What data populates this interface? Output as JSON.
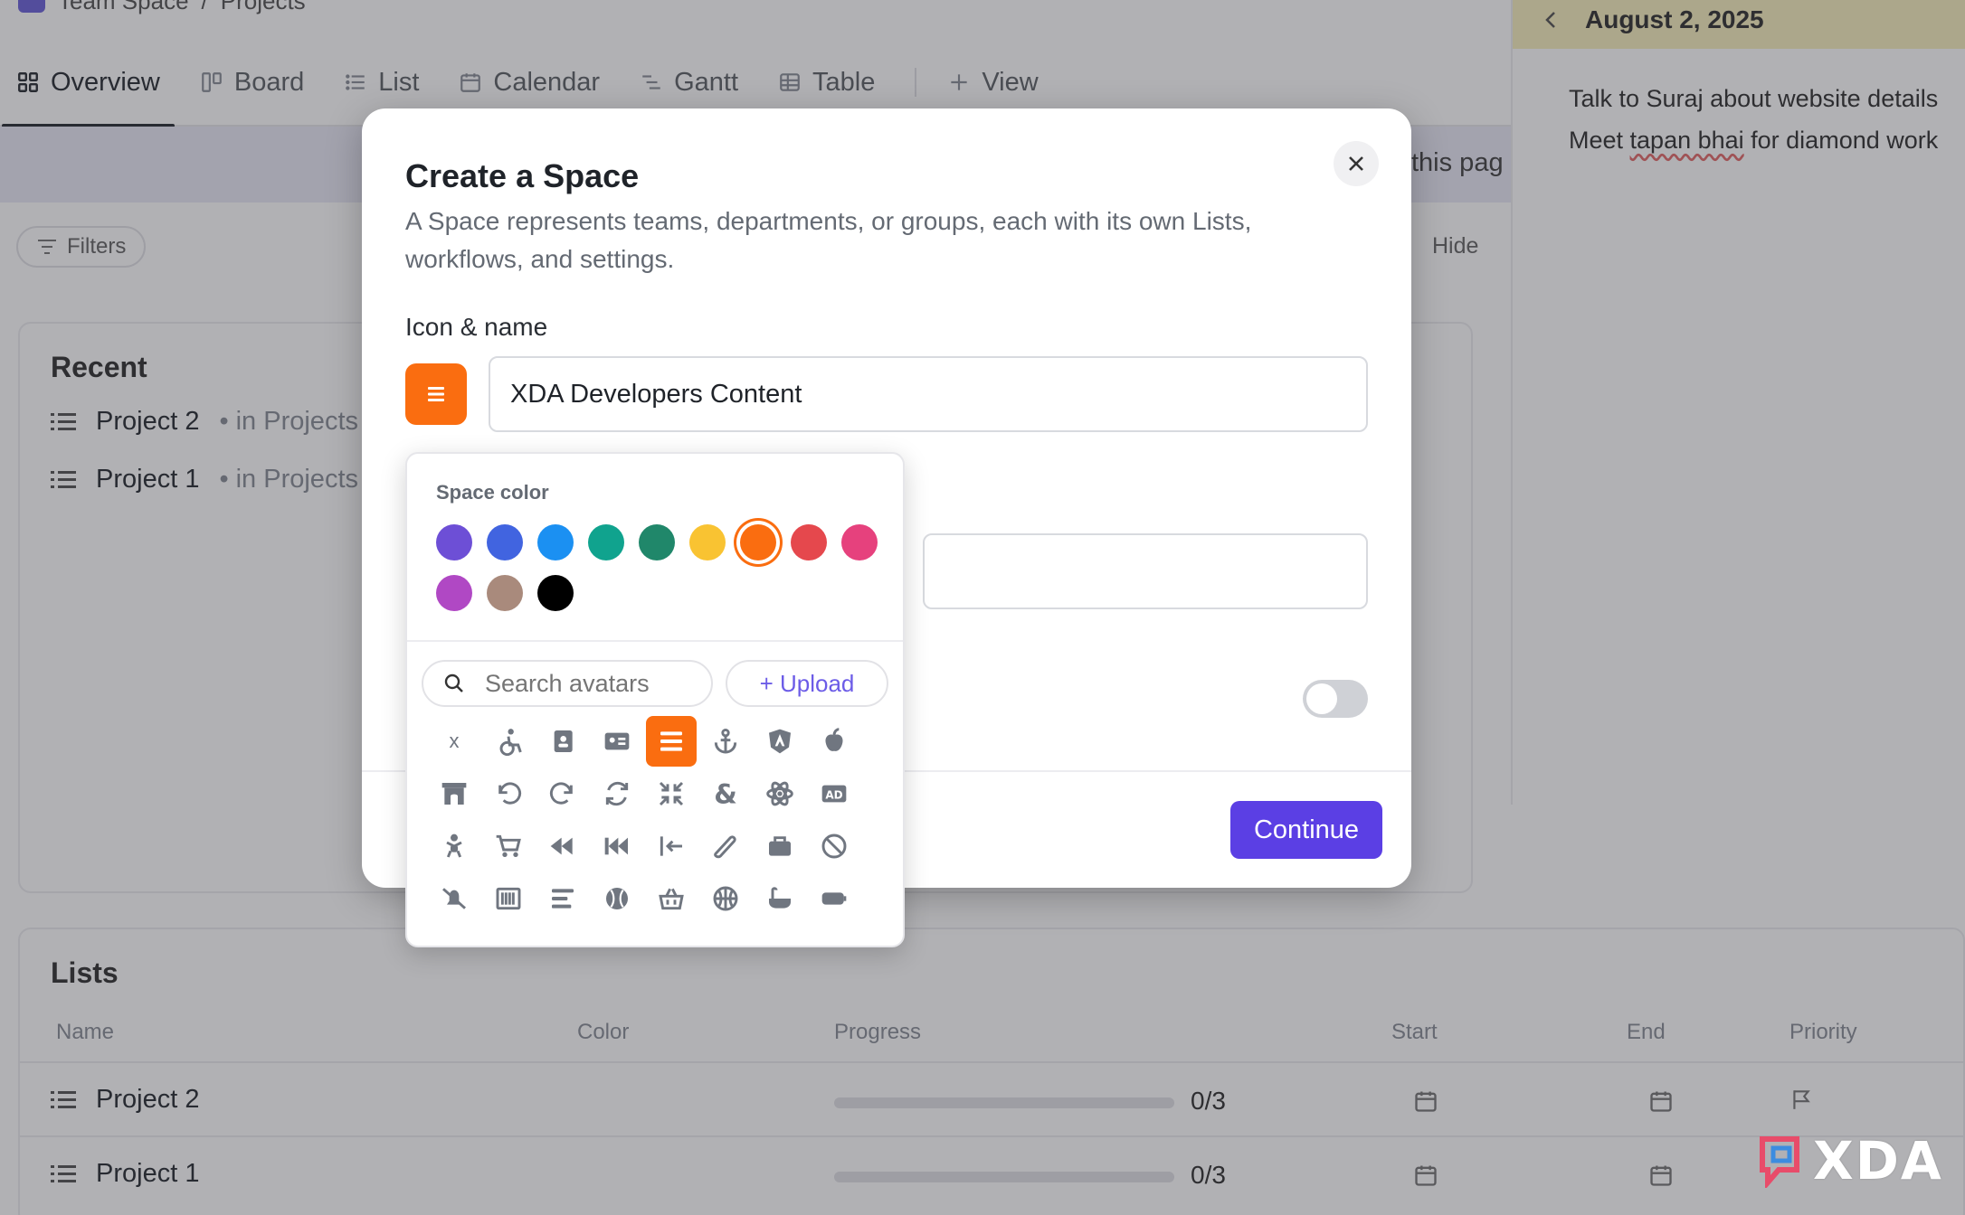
{
  "breadcrumb": {
    "space": "Team Space",
    "folder": "Projects"
  },
  "tabs": [
    {
      "label": "Overview",
      "icon": "overview-grid-icon"
    },
    {
      "label": "Board",
      "icon": "board-icon"
    },
    {
      "label": "List",
      "icon": "list-icon"
    },
    {
      "label": "Calendar",
      "icon": "calendar-icon"
    },
    {
      "label": "Gantt",
      "icon": "gantt-icon"
    },
    {
      "label": "Table",
      "icon": "table-icon"
    },
    {
      "label": "View",
      "icon": "plus-icon"
    }
  ],
  "banner": {
    "text": "this pag"
  },
  "toolbar": {
    "filters_label": "Filters",
    "hide_label": "Hide"
  },
  "recent": {
    "title": "Recent",
    "items": [
      {
        "name": "Project 2",
        "location": "in Projects"
      },
      {
        "name": "Project 1",
        "location": "in Projects"
      }
    ]
  },
  "calendar_panel": {
    "date": "August 2, 2025",
    "notes": [
      "Talk to Suraj about website details",
      "Meet ",
      "tapan bhai",
      " for diamond work"
    ]
  },
  "lists": {
    "title": "Lists",
    "columns": [
      "Name",
      "Color",
      "Progress",
      "Start",
      "End",
      "Priority"
    ],
    "rows": [
      {
        "name": "Project 2",
        "progress": "0/3",
        "progress_fraction": 0
      },
      {
        "name": "Project 1",
        "progress": "0/3",
        "progress_fraction": 0
      }
    ]
  },
  "modal": {
    "title": "Create a Space",
    "description": "A Space represents teams, departments, or groups, each with its own Lists, workflows, and settings.",
    "icon_name_label": "Icon & name",
    "name_value": "XDA Developers Content",
    "continue_label": "Continue",
    "close_icon": "close-icon"
  },
  "picker": {
    "space_color_label": "Space color",
    "colors": [
      "#6d4fd6",
      "#4164e0",
      "#1b90f2",
      "#10a38e",
      "#20876a",
      "#f9c332",
      "#fa6d10",
      "#e5484d",
      "#e6417d",
      "#b048c4",
      "#a98a7c",
      "#000000"
    ],
    "selected_color": "#fa6d10",
    "search_placeholder": "Search avatars",
    "upload_label": "+ Upload",
    "icons": [
      "x-letter",
      "wheelchair-icon",
      "address-book-icon",
      "id-card-icon",
      "align-justify-icon",
      "anchor-icon",
      "angular-icon",
      "apple-icon",
      "archway-icon",
      "undo-icon",
      "redo-icon",
      "sync-icon",
      "compress-icon",
      "ampersand-icon",
      "atom-icon",
      "ad-icon",
      "baby-icon",
      "cart-icon",
      "backward-icon",
      "fast-backward-icon",
      "arrow-to-left-icon",
      "bandage-icon",
      "briefcase-icon",
      "ban-icon",
      "bell-slash-icon",
      "barcode-icon",
      "align-left-icon",
      "baseball-icon",
      "basket-icon",
      "basketball-icon",
      "bath-icon",
      "battery-icon"
    ],
    "selected_icon": "align-justify-icon"
  },
  "watermark": {
    "text": "XDA"
  }
}
